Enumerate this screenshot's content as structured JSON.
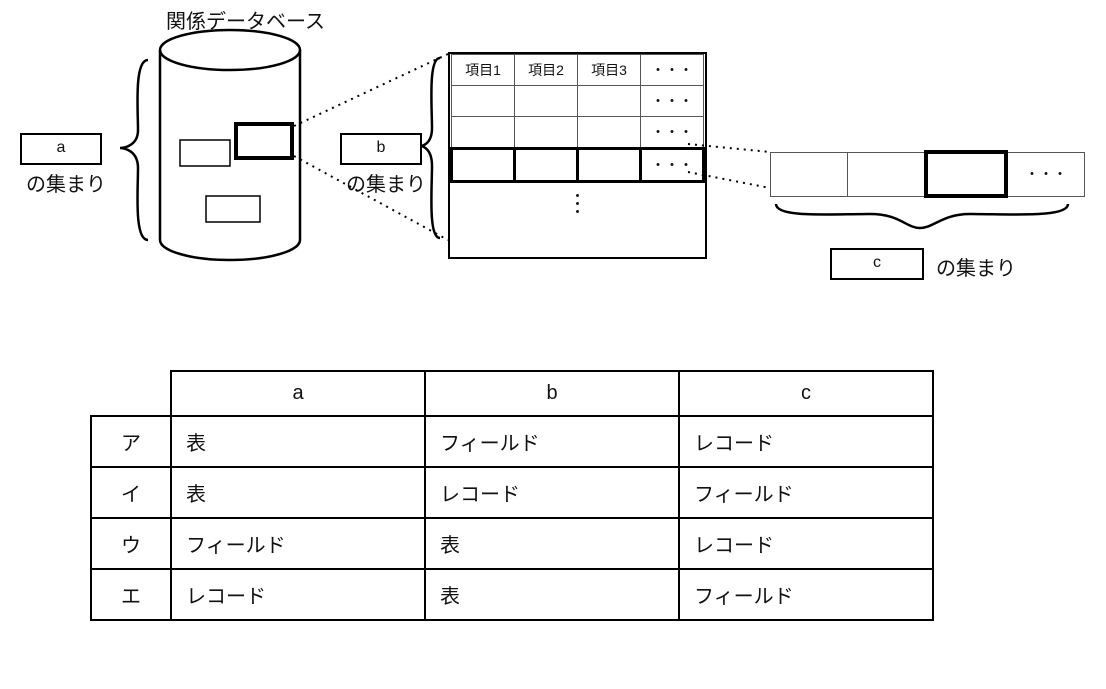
{
  "title": "関係データベース",
  "labels": {
    "a": "a",
    "b": "b",
    "c": "c",
    "collection": "の集まり"
  },
  "grid_headers": [
    "項目1",
    "項目2",
    "項目3",
    "・・・"
  ],
  "dots": "・・・",
  "vdot": "・",
  "answer_table": {
    "headers": [
      "a",
      "b",
      "c"
    ],
    "rows": [
      {
        "key": "ア",
        "cells": [
          "表",
          "フィールド",
          "レコード"
        ]
      },
      {
        "key": "イ",
        "cells": [
          "表",
          "レコード",
          "フィールド"
        ]
      },
      {
        "key": "ウ",
        "cells": [
          "フィールド",
          "表",
          "レコード"
        ]
      },
      {
        "key": "エ",
        "cells": [
          "レコード",
          "表",
          "フィールド"
        ]
      }
    ]
  }
}
